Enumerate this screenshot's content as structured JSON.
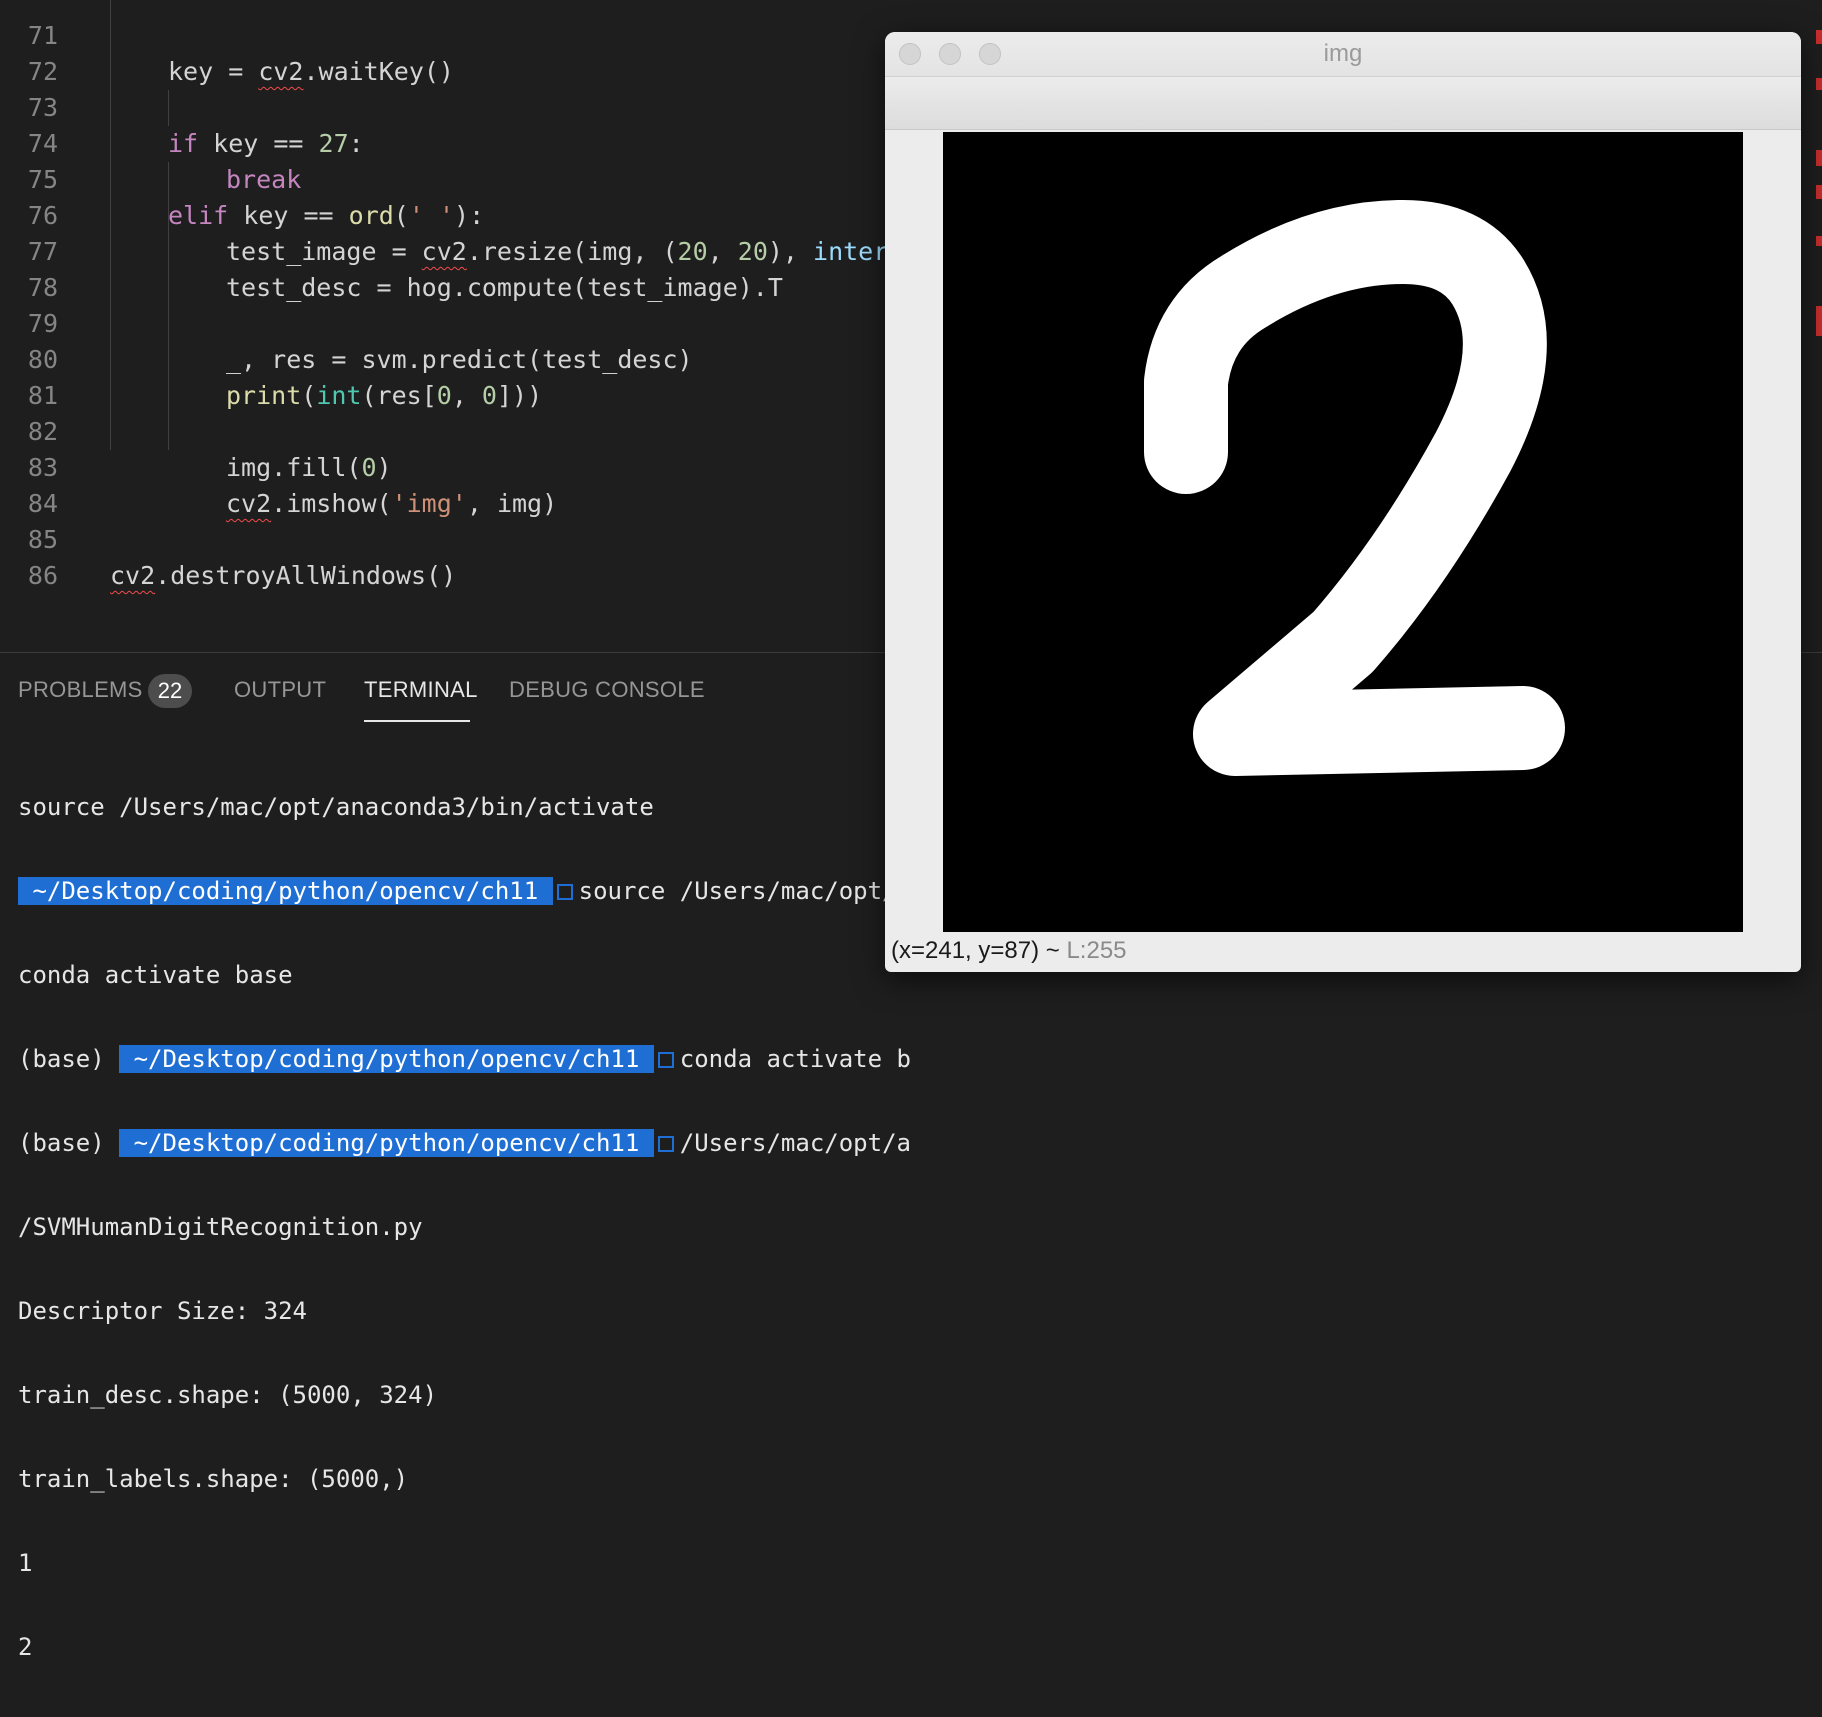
{
  "editor": {
    "lines": [
      {
        "n": "71"
      },
      {
        "n": "72"
      },
      {
        "n": "73"
      },
      {
        "n": "74"
      },
      {
        "n": "75"
      },
      {
        "n": "76"
      },
      {
        "n": "77"
      },
      {
        "n": "78"
      },
      {
        "n": "79"
      },
      {
        "n": "80"
      },
      {
        "n": "81"
      },
      {
        "n": "82"
      },
      {
        "n": "83"
      },
      {
        "n": "84"
      },
      {
        "n": "85"
      },
      {
        "n": "86"
      }
    ],
    "code": {
      "l71_a": "key = ",
      "l71_b": "cv2",
      "l71_c": ".waitKey()",
      "l73_kw": "if",
      "l73_a": " key == ",
      "l73_num": "27",
      "l73_b": ":",
      "l74_kw": "break",
      "l75_kw": "elif",
      "l75_a": " key == ",
      "l75_fn": "ord",
      "l75_b": "(",
      "l75_str": "' '",
      "l75_c": "):",
      "l76_a": "test_image = ",
      "l76_b": "cv2",
      "l76_c": ".resize(img, (",
      "l76_n1": "20",
      "l76_d": ", ",
      "l76_n2": "20",
      "l76_e": "), ",
      "l76_p": "interpo",
      "l77_a": "test_desc = hog.compute(test_image).T",
      "l79_a": "_, res = svm.predict(test_desc)",
      "l80_fn": "print",
      "l80_a": "(",
      "l80_bi": "int",
      "l80_b": "(res[",
      "l80_n1": "0",
      "l80_c": ", ",
      "l80_n2": "0",
      "l80_d": "]))",
      "l82_a": "img.fill(",
      "l82_n": "0",
      "l82_b": ")",
      "l83_a": "cv2",
      "l83_b": ".imshow(",
      "l83_str": "'img'",
      "l83_c": ", img)",
      "l85_a": "cv2",
      "l85_b": ".destroyAllWindows()"
    }
  },
  "panel": {
    "tabs": {
      "problems": "PROBLEMS",
      "problems_count": "22",
      "output": "OUTPUT",
      "terminal": "TERMINAL",
      "debug": "DEBUG CONSOLE"
    },
    "terminal": {
      "t1": "source /Users/mac/opt/anaconda3/bin/activate",
      "t2_path": " ~/Desktop/coding/python/opencv/ch11 ",
      "t2_cmd": "source /Users/mac/opt/a",
      "t3": "conda activate base",
      "t4_pre": "(base) ",
      "t4_path": " ~/Desktop/coding/python/opencv/ch11 ",
      "t4_cmd": "conda activate b",
      "t5_pre": "(base) ",
      "t5_path": " ~/Desktop/coding/python/opencv/ch11 ",
      "t5_cmd": "/Users/mac/opt/a",
      "t6": "/SVMHumanDigitRecognition.py",
      "t7": "Descriptor Size: 324",
      "t8": "train_desc.shape: (5000, 324)",
      "t9": "train_labels.shape: (5000,)",
      "t10": "1",
      "t11": "2"
    }
  },
  "window": {
    "title": "img",
    "status_coords": "(x=241, y=87) ~ ",
    "status_value": "L:255"
  }
}
